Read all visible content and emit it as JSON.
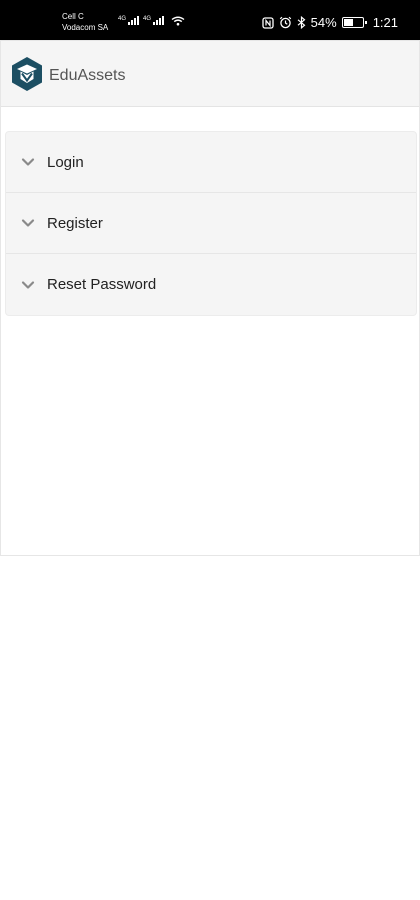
{
  "status_bar": {
    "carrier_1": "Cell C",
    "carrier_2": "Vodacom SA",
    "network_tag": "4G",
    "battery_percent": "54%",
    "battery_level": 0.54,
    "time": "1:21",
    "icons": [
      "signal-icon",
      "wifi-icon",
      "nfc-icon",
      "alarm-icon",
      "bluetooth-icon",
      "battery-icon"
    ]
  },
  "app": {
    "title": "EduAssets",
    "logo_icon": "eduassets-logo-icon",
    "brand_color": "#1c4f63"
  },
  "accordion": {
    "items": [
      {
        "label": "Login",
        "icon": "chevron-down-icon"
      },
      {
        "label": "Register",
        "icon": "chevron-down-icon"
      },
      {
        "label": "Reset Password",
        "icon": "chevron-down-icon"
      }
    ]
  }
}
